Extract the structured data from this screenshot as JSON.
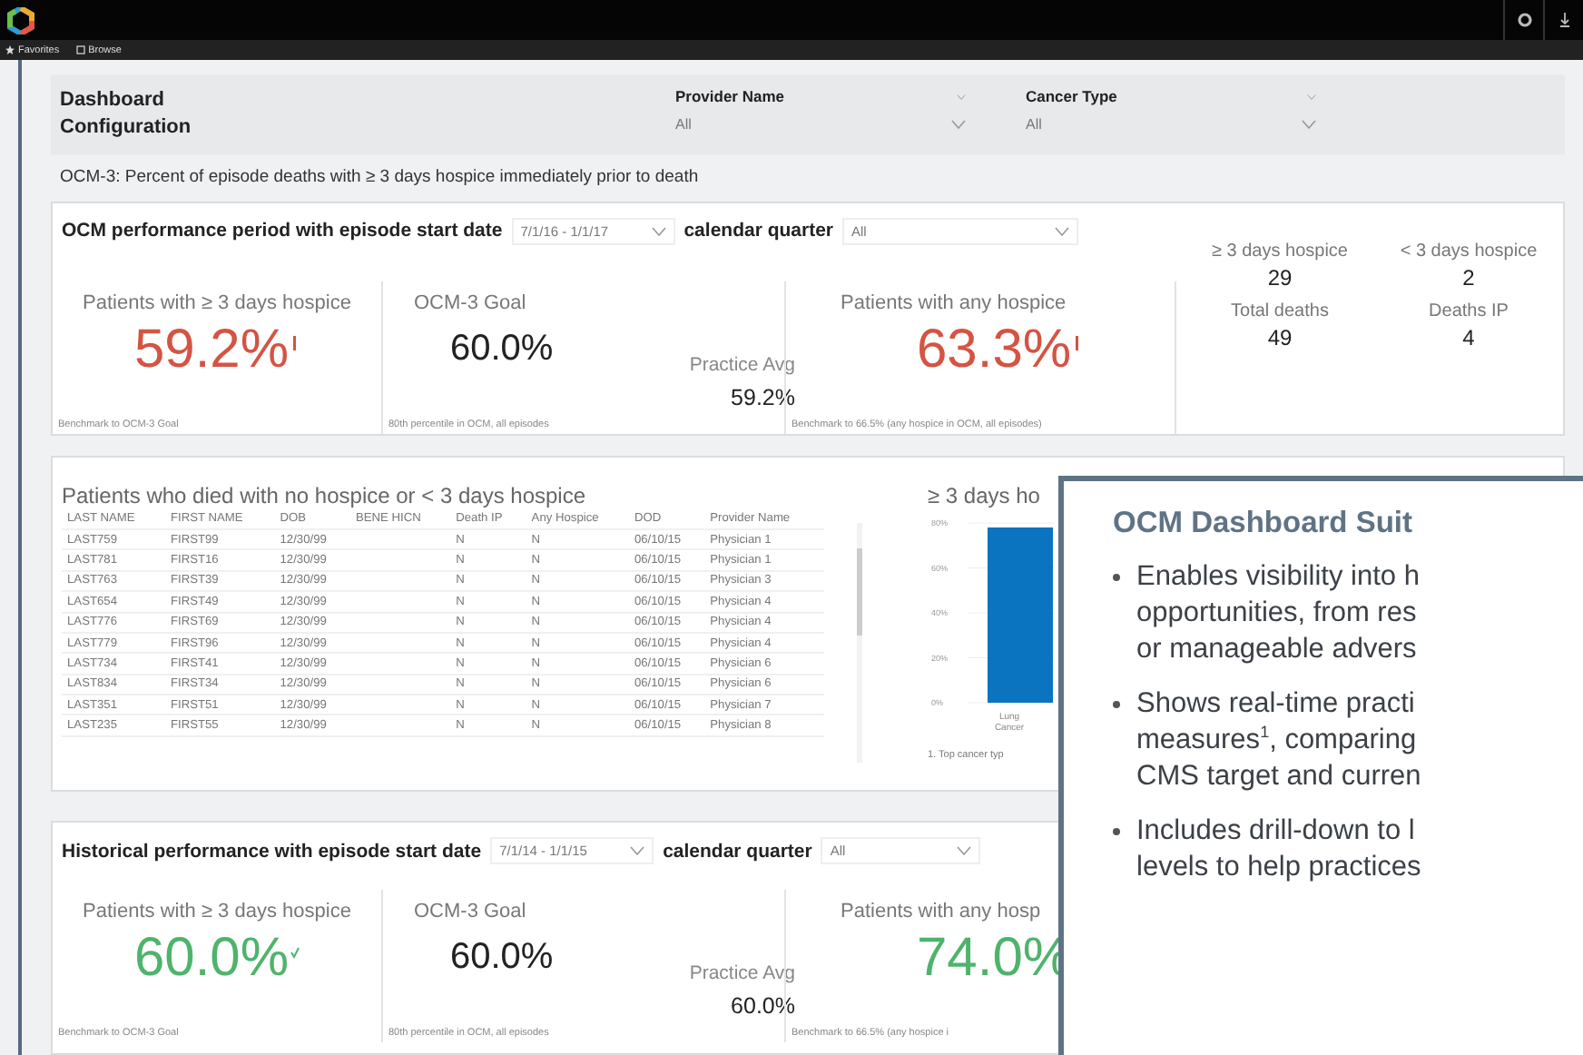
{
  "app_bar": {
    "nav": [
      {
        "kind": "star",
        "label": "Favorites"
      },
      {
        "kind": "page",
        "label": "Browse"
      }
    ]
  },
  "config": {
    "title": "Dashboard Configuration",
    "filters": [
      {
        "label": "Provider Name",
        "value": "All"
      },
      {
        "label": "Cancer Type",
        "value": "All"
      }
    ]
  },
  "measure_caption": "OCM-3: Percent of episode deaths with ≥ 3 days hospice immediately prior to death",
  "current_period": {
    "title": "OCM performance period with episode start date",
    "date_range": "7/1/16 - 1/1/17",
    "quarter_label": "calendar quarter",
    "quarter": "All",
    "primary": {
      "label": "Patients with ≥ 3 days hospice",
      "value": "59.2%",
      "color": "#d45443",
      "kind": "bar",
      "note": "Benchmark to OCM-3 Goal"
    },
    "goal": {
      "label": "OCM-3 Goal",
      "value": "60.0%",
      "note": "80th percentile in OCM, all episodes"
    },
    "practice_avg": {
      "label": "Practice Avg",
      "value": "59.2%"
    },
    "any_hospice": {
      "label": "Patients with any hospice",
      "value": "63.3%",
      "color": "#d45443",
      "kind": "bar",
      "note": "Benchmark to 66.5% (any hospice in OCM, all episodes)"
    },
    "counts": [
      {
        "label": "≥ 3 days hospice",
        "value": "29"
      },
      {
        "label": "< 3 days hospice",
        "value": "2"
      },
      {
        "label": "Total deaths",
        "value": "49"
      },
      {
        "label": "Deaths IP",
        "value": "4"
      }
    ]
  },
  "patients": {
    "title": "Patients who died with no hospice or < 3 days hospice",
    "columns": [
      "LAST NAME",
      "FIRST NAME",
      "DOB",
      "BENE HICN",
      "Death IP",
      "Any Hospice",
      "DOD",
      "Provider Name"
    ],
    "rows": [
      [
        "LAST759",
        "FIRST99",
        "12/30/99",
        "",
        "N",
        "N",
        "06/10/15",
        "Physician 1"
      ],
      [
        "LAST781",
        "FIRST16",
        "12/30/99",
        "",
        "N",
        "N",
        "06/10/15",
        "Physician 1"
      ],
      [
        "LAST763",
        "FIRST39",
        "12/30/99",
        "",
        "N",
        "N",
        "06/10/15",
        "Physician 3"
      ],
      [
        "LAST654",
        "FIRST49",
        "12/30/99",
        "",
        "N",
        "N",
        "06/10/15",
        "Physician 4"
      ],
      [
        "LAST776",
        "FIRST69",
        "12/30/99",
        "",
        "N",
        "N",
        "06/10/15",
        "Physician 4"
      ],
      [
        "LAST779",
        "FIRST96",
        "12/30/99",
        "",
        "N",
        "N",
        "06/10/15",
        "Physician 4"
      ],
      [
        "LAST734",
        "FIRST41",
        "12/30/99",
        "",
        "N",
        "N",
        "06/10/15",
        "Physician 6"
      ],
      [
        "LAST834",
        "FIRST34",
        "12/30/99",
        "",
        "N",
        "N",
        "06/10/15",
        "Physician 6"
      ],
      [
        "LAST351",
        "FIRST51",
        "12/30/99",
        "",
        "N",
        "N",
        "06/10/15",
        "Physician 7"
      ],
      [
        "LAST235",
        "FIRST55",
        "12/30/99",
        "",
        "N",
        "N",
        "06/10/15",
        "Physician 8"
      ]
    ]
  },
  "cancer_chart": {
    "chart_data": {
      "type": "bar",
      "grid": true,
      "title": "≥ 3 days ho",
      "categories": [
        "Lung Cancer"
      ],
      "values": [
        78
      ],
      "ylim": [
        0,
        80
      ],
      "yticks": [
        {
          "value": 0,
          "label": "0%"
        },
        {
          "value": 20,
          "label": "20%"
        },
        {
          "value": 40,
          "label": "40%"
        },
        {
          "value": 60,
          "label": "60%"
        },
        {
          "value": 80,
          "label": "80%"
        }
      ]
    },
    "footnote": "1. Top cancer typ"
  },
  "historical": {
    "title": "Historical performance with episode start date",
    "date_range": "7/1/14 - 1/1/15",
    "quarter_label": "calendar quarter",
    "quarter": "All",
    "primary": {
      "label": "Patients with ≥ 3 days hospice",
      "value": "60.0%",
      "color": "#4fb36c",
      "kind": "check",
      "note": "Benchmark to OCM-3 Goal"
    },
    "goal": {
      "label": "OCM-3 Goal",
      "value": "60.0%",
      "note": "80th percentile in OCM, all episodes"
    },
    "practice_avg": {
      "label": "Practice Avg",
      "value": "60.0%"
    },
    "any_hospice": {
      "label": "Patients with any hosp",
      "value": "74.0%",
      "color": "#4fb36c",
      "note": "Benchmark to 66.5% (any hospice i"
    }
  },
  "callout": {
    "title": "OCM Dashboard Suit",
    "bullets": [
      {
        "lines": [
          "Enables visibility into h",
          "opportunities, from res",
          "or manageable advers"
        ]
      },
      {
        "lines": [
          "Shows real-time practi",
          "measures$^{1}$, comparing",
          "CMS target and curren"
        ]
      },
      {
        "lines": [
          "Includes drill-down to l",
          "levels to help practices"
        ]
      }
    ]
  }
}
